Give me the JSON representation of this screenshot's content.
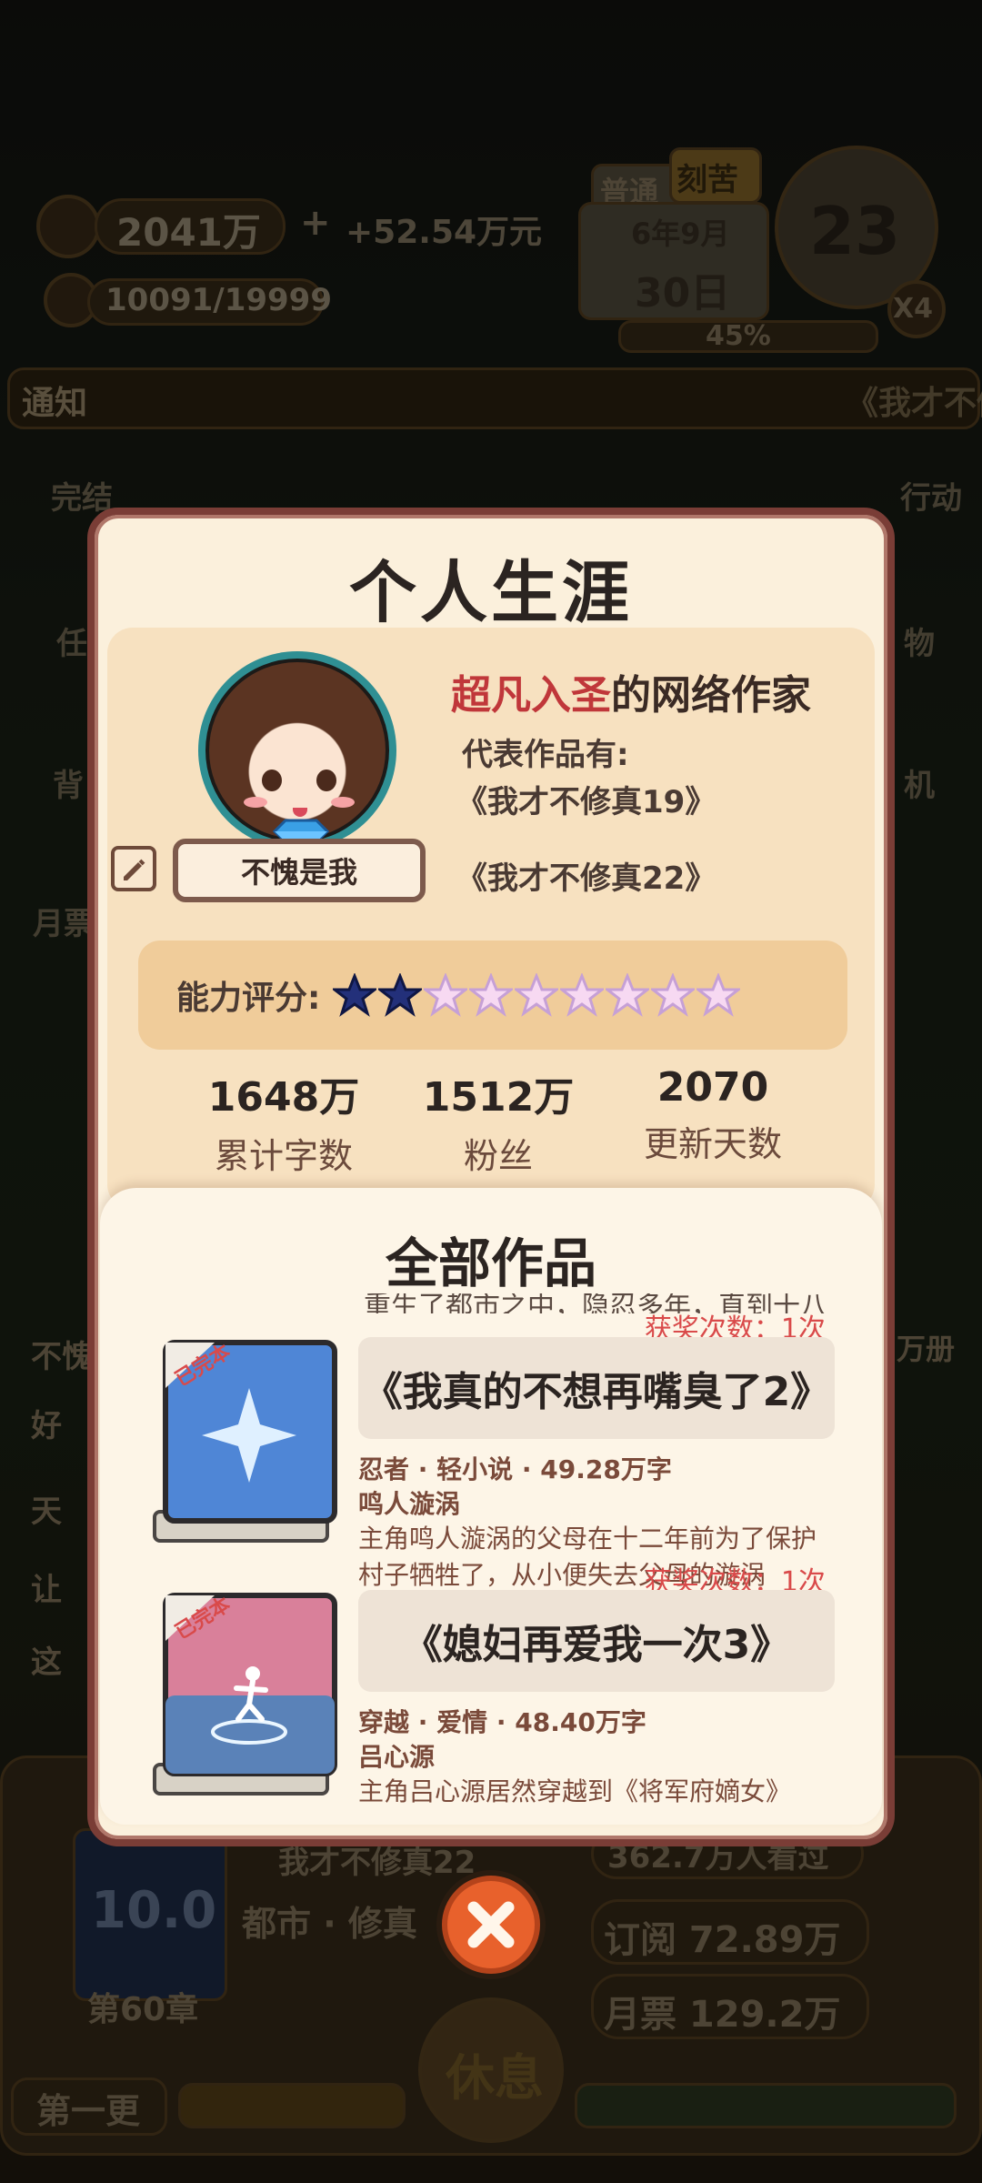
{
  "background": {
    "currency": "2041万",
    "income": "+52.54万元",
    "energy": "10091/19999",
    "mode_tabs": [
      "普通",
      "刻苦"
    ],
    "date_year_month": "6年9月",
    "date_day": "30日",
    "day_counter": "23",
    "speed": "X4",
    "progress_percent": "45%",
    "notice_label": "通知",
    "notice_text": "《我才不修",
    "side_left": [
      "完结",
      "任",
      "背",
      "月票"
    ],
    "side_right": [
      "行动",
      "物",
      "机"
    ],
    "list_left": [
      "不愧",
      "好",
      "天",
      "让",
      "这"
    ],
    "right_tag": "万册",
    "book_rating": "10.0",
    "chapter": "第60章",
    "book_name": "我才不修真22",
    "book_genre": "都市 · 修真",
    "readers": "362.7万人看过",
    "subscribe": "订阅 72.89万",
    "monthly_ticket": "月票 129.2万",
    "first_update": "第一更",
    "rest_button": "休息"
  },
  "modal": {
    "title": "个人生涯",
    "profile": {
      "rank": "超凡入圣",
      "writer_suffix": "的网络作家",
      "works_label": "代表作品有:",
      "rep_works": [
        "《我才不修真19》",
        "《我才不修真22》"
      ],
      "name": "不愧是我",
      "rating_label": "能力评分:",
      "rating": {
        "filled": 2,
        "total": 9
      },
      "stats": [
        {
          "value": "1648万",
          "label": "累计字数"
        },
        {
          "value": "1512万",
          "label": "粉丝"
        },
        {
          "value": "2070",
          "label": "更新天数"
        }
      ]
    },
    "works_title": "全部作品",
    "cut_text": "重生了都市之中，隐忍多年，直到十八",
    "works": [
      {
        "award": "获奖次数：1次",
        "status": "已完本",
        "title": "《我真的不想再嘴臭了2》",
        "meta": "忍者 · 轻小说 · 49.28万字",
        "hero": "鸣人漩涡",
        "desc": "主角鸣人漩涡的父母在十二年前为了保护村子牺牲了，从小便失去父母的漩涡",
        "cover": "#4f86d6"
      },
      {
        "award": "获奖次数：1次",
        "status": "已完本",
        "title": "《媳妇再爱我一次3》",
        "meta": "穿越 · 爱情 · 48.40万字",
        "hero": "吕心源",
        "desc": "主角吕心源居然穿越到《将军府嫡女》",
        "cover": "#d9809a"
      }
    ]
  }
}
